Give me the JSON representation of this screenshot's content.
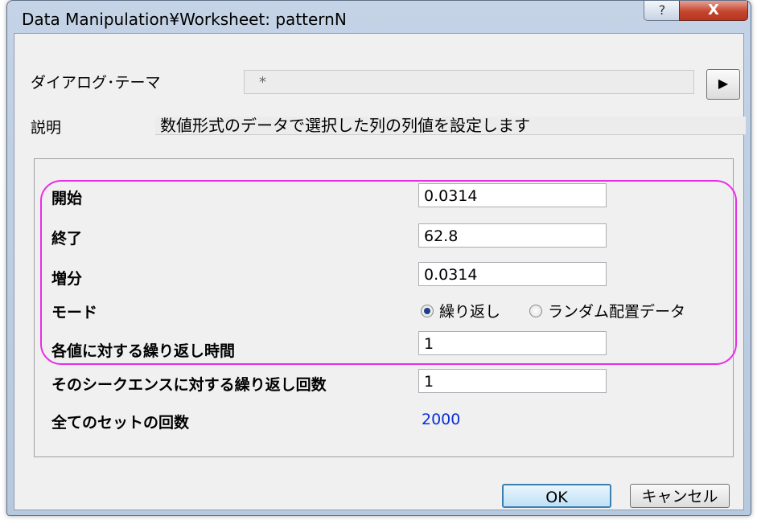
{
  "window": {
    "title": "Data Manipulation¥Worksheet: patternN",
    "help_label": "?",
    "close_label": "X"
  },
  "theme": {
    "label": "ダイアログ･テーマ",
    "value": "*",
    "arrow": "▶"
  },
  "description": {
    "label": "説明",
    "text": "数値形式のデータで選択した列の列値を設定します"
  },
  "fields": {
    "start": {
      "label": "開始",
      "value": "0.0314"
    },
    "end": {
      "label": "終了",
      "value": "62.8"
    },
    "increment": {
      "label": "増分",
      "value": "0.0314"
    },
    "mode": {
      "label": "モード",
      "options": [
        "繰り返し",
        "ランダム配置データ"
      ],
      "selected": "繰り返し"
    },
    "repeat_each": {
      "label": "各値に対する繰り返し時間",
      "value": "1"
    },
    "repeat_sequence": {
      "label": "そのシークエンスに対する繰り返し回数",
      "value": "1"
    },
    "total": {
      "label": "全てのセットの回数",
      "value": "2000"
    }
  },
  "buttons": {
    "ok": "OK",
    "cancel": "キャンセル"
  },
  "colors": {
    "highlight": "#e62ee6",
    "link_value": "#0b2fd8",
    "dialog_bg": "#f0f0f0"
  }
}
